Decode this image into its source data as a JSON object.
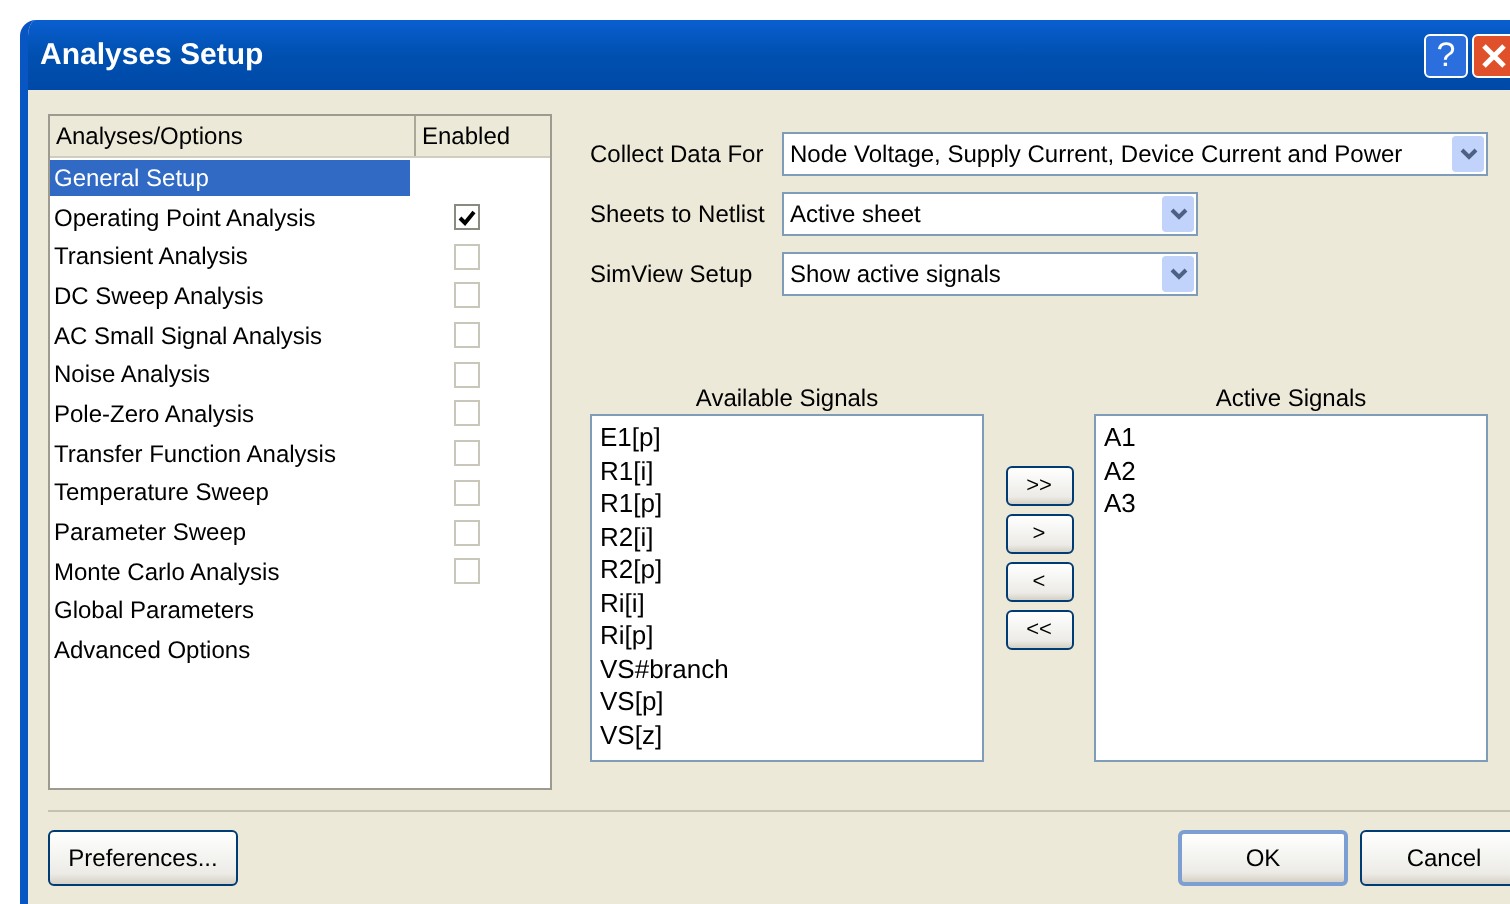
{
  "window": {
    "title": "Analyses Setup",
    "help_button": "?"
  },
  "analyses": {
    "columns": [
      "Analyses/Options",
      "Enabled"
    ],
    "items": [
      {
        "label": "General Setup",
        "selected": true
      },
      {
        "label": "Operating Point Analysis",
        "selected": false,
        "enabled": true
      },
      {
        "label": "Transient Analysis",
        "selected": false,
        "enabled": false
      },
      {
        "label": "DC Sweep Analysis",
        "selected": false,
        "enabled": false
      },
      {
        "label": "AC Small Signal Analysis",
        "selected": false,
        "enabled": false
      },
      {
        "label": "Noise Analysis",
        "selected": false,
        "enabled": false
      },
      {
        "label": "Pole-Zero Analysis",
        "selected": false,
        "enabled": false
      },
      {
        "label": "Transfer Function Analysis",
        "selected": false,
        "enabled": false
      },
      {
        "label": "Temperature Sweep",
        "selected": false,
        "enabled": false
      },
      {
        "label": "Parameter Sweep",
        "selected": false,
        "enabled": false
      },
      {
        "label": "Monte Carlo Analysis",
        "selected": false,
        "enabled": false
      },
      {
        "label": "Global Parameters",
        "selected": false
      },
      {
        "label": "Advanced Options",
        "selected": false
      }
    ]
  },
  "settings": [
    {
      "label": "Collect Data For",
      "value": "Node Voltage, Supply Current, Device Current and Power"
    },
    {
      "label": "Sheets to Netlist",
      "value": "Active sheet"
    },
    {
      "label": "SimView Setup",
      "value": "Show active signals"
    }
  ],
  "available_signals": {
    "title": "Available Signals",
    "items": [
      "E1[p]",
      "R1[i]",
      "R1[p]",
      "R2[i]",
      "R2[p]",
      "Ri[i]",
      "Ri[p]",
      "VS#branch",
      "VS[p]",
      "VS[z]"
    ]
  },
  "transfer_buttons": [
    ">>",
    ">",
    "<",
    "<<"
  ],
  "active_signals": {
    "title": "Active Signals",
    "items": [
      "A1",
      "A2",
      "A3"
    ]
  },
  "buttons": {
    "preferences": "Preferences...",
    "ok": "OK",
    "cancel": "Cancel"
  }
}
